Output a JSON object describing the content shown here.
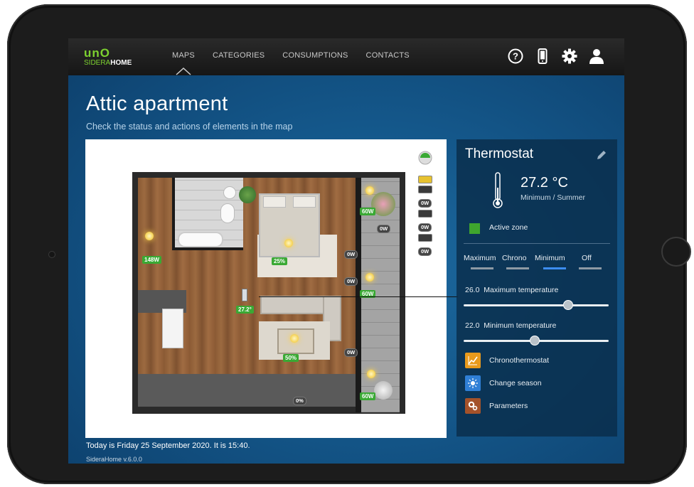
{
  "app": {
    "logo": {
      "uno": "unO",
      "sub_a": "SIDERA",
      "sub_b": "HOME"
    },
    "nav": [
      "MAPS",
      "CATEGORIES",
      "CONSUMPTIONS",
      "CONTACTS"
    ],
    "active_nav": "MAPS",
    "top_icons": [
      "help-icon",
      "mobile-icon",
      "gear-icon",
      "user-icon"
    ]
  },
  "page": {
    "title": "Attic apartment",
    "subtitle": "Check the status and actions of elements in the map"
  },
  "map": {
    "badges": {
      "bed_lamp": "25%",
      "table_lamp": "50%",
      "left_wall": "148W",
      "thermostat": "27.2°",
      "terrace_top": "60W",
      "terrace_bottom": "60W",
      "terrace_low_right": "0W",
      "terrace_mid_right": "60W",
      "socket_a": "0W",
      "socket_b": "0W",
      "socket_c": "0W",
      "window": "0%"
    },
    "legend": [
      "0W",
      "0W",
      "0W"
    ]
  },
  "panel": {
    "title": "Thermostat",
    "temperature": "27.2 °C",
    "mode_summary": "Minimum / Summer",
    "zone_label": "Active zone",
    "zone_color": "#3fa52e",
    "modes": [
      {
        "label": "Maximum",
        "active": false
      },
      {
        "label": "Chrono",
        "active": false
      },
      {
        "label": "Minimum",
        "active": true
      },
      {
        "label": "Off",
        "active": false
      }
    ],
    "max_temp": {
      "value": "26.0",
      "label": "Maximum temperature",
      "level": 0.72
    },
    "min_temp": {
      "value": "22.0",
      "label": "Minimum temperature",
      "level": 0.49
    },
    "actions": [
      {
        "label": "Chronothermostat",
        "color": "#e89a1c",
        "icon": "chart-icon"
      },
      {
        "label": "Change season",
        "color": "#2f7fd6",
        "icon": "sun-icon"
      },
      {
        "label": "Parameters",
        "color": "#a4522a",
        "icon": "gears-icon"
      }
    ]
  },
  "footer": {
    "date_text": "Today is Friday 25 September 2020. It is 15:40.",
    "version": "SideraHome v.6.0.0"
  }
}
